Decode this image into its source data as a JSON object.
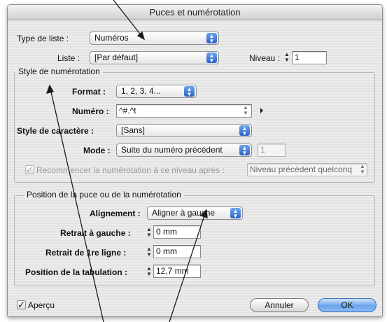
{
  "dialog": {
    "title": "Puces et numérotation"
  },
  "type_liste": {
    "label": "Type de liste :",
    "value": "Numéros"
  },
  "liste": {
    "label": "Liste :",
    "value": "[Par défaut]"
  },
  "niveau": {
    "label": "Niveau :",
    "value": "1"
  },
  "style_numerotation": {
    "group_title": "Style de numérotation",
    "format_label": "Format :",
    "format_value": "1, 2, 3, 4...",
    "numero_label": "Numéro :",
    "numero_value": "^#.^t",
    "style_caractere_label": "Style de caractère :",
    "style_caractere_value": "[Sans]",
    "mode_label": "Mode :",
    "mode_value": "Suite du numéro précédent",
    "mode_number": "1",
    "restart_label": "Recommencer la numérotation à ce niveau après :",
    "restart_value": "Niveau précédent quelconq"
  },
  "position": {
    "group_title": "Position de la puce ou de la numérotation",
    "alignement_label": "Alignement :",
    "alignement_value": "Aligner à gauche",
    "retrait_gauche_label": "Retrait à gauche :",
    "retrait_gauche_value": "0 mm",
    "retrait_ligne_label": "Retrait de 1re ligne :",
    "retrait_ligne_value": "0 mm",
    "tabulation_label": "Position de la tabulation :",
    "tabulation_value": "12,7 mm"
  },
  "footer": {
    "apercu_label": "Aperçu",
    "cancel_label": "Annuler",
    "ok_label": "OK"
  },
  "icons": {
    "popup_arrows": "updown-arrows-icon",
    "stepper": "stepper-icon",
    "checkmark": "checkmark-icon",
    "submenu": "triangle-right-icon"
  },
  "colors": {
    "accent_blue": "#3a78d8",
    "default_button": "#6aa4ee",
    "annotation_line": "#1a1a1a"
  }
}
